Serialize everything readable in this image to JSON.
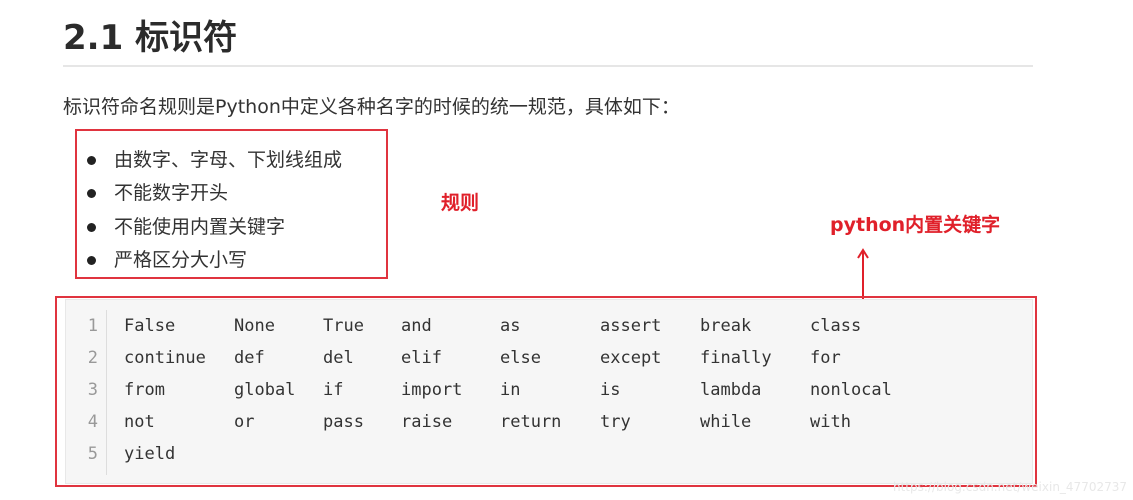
{
  "title": "2.1 标识符",
  "intro": "标识符命名规则是Python中定义各种名字的时候的统一规范，具体如下：",
  "rules": [
    "由数字、字母、下划线组成",
    "不能数字开头",
    "不能使用内置关键字",
    "严格区分大小写"
  ],
  "annotations": {
    "rules_label": "规则",
    "keywords_label": "python内置关键字"
  },
  "code": {
    "line_numbers": [
      "1",
      "2",
      "3",
      "4",
      "5"
    ],
    "rows": [
      [
        "False",
        "None",
        "True",
        "and",
        "as",
        "assert",
        "break",
        "class"
      ],
      [
        "continue",
        "def",
        "del",
        "elif",
        "else",
        "except",
        "finally",
        "for"
      ],
      [
        "from",
        "global",
        "if",
        "import",
        "in",
        "is",
        "lambda",
        "nonlocal"
      ],
      [
        "not",
        "or",
        "pass",
        "raise",
        "return",
        "try",
        "while",
        "with"
      ],
      [
        "yield"
      ]
    ]
  },
  "watermark": "https://blog.csdn.net/weixin_47702737",
  "colors": {
    "annotation": "#e0202a",
    "code_bg": "#f6f6f6"
  }
}
